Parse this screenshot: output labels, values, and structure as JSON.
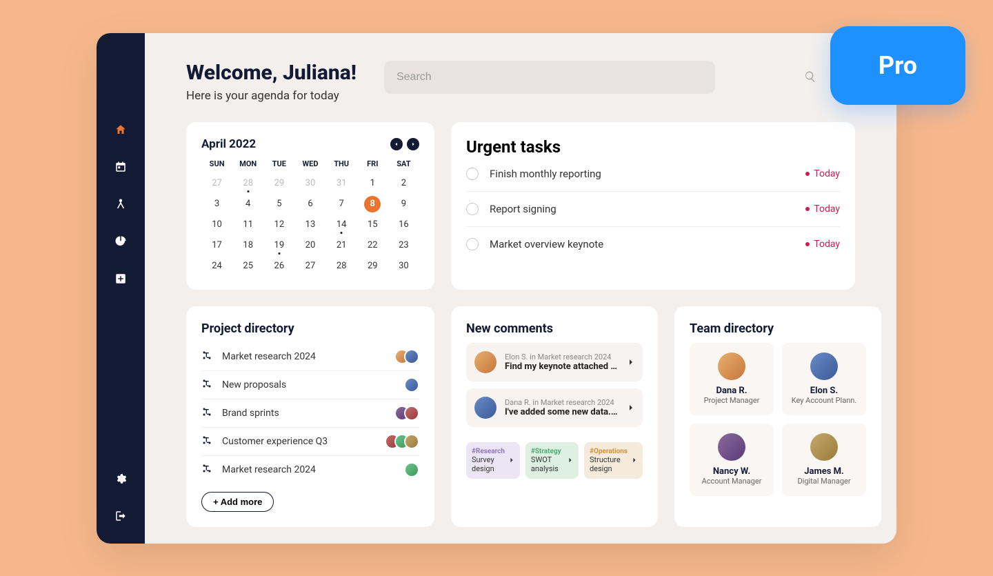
{
  "pro_label": "Pro",
  "header": {
    "title": "Welcome, Juliana!",
    "subtitle": "Here is your agenda for today"
  },
  "search": {
    "placeholder": "Search"
  },
  "calendar": {
    "month": "April 2022",
    "dow": [
      "SUN",
      "MON",
      "TUE",
      "WED",
      "THU",
      "FRI",
      "SAT"
    ],
    "cells": [
      {
        "n": "27",
        "muted": true
      },
      {
        "n": "28",
        "muted": true,
        "dot": true
      },
      {
        "n": "29",
        "muted": true
      },
      {
        "n": "30",
        "muted": true
      },
      {
        "n": "31",
        "muted": true
      },
      {
        "n": "1"
      },
      {
        "n": "2"
      },
      {
        "n": "3"
      },
      {
        "n": "4"
      },
      {
        "n": "5"
      },
      {
        "n": "6"
      },
      {
        "n": "7"
      },
      {
        "n": "8",
        "today": true
      },
      {
        "n": "9"
      },
      {
        "n": "10"
      },
      {
        "n": "11"
      },
      {
        "n": "12"
      },
      {
        "n": "13"
      },
      {
        "n": "14",
        "dot": true
      },
      {
        "n": "15"
      },
      {
        "n": "16"
      },
      {
        "n": "17"
      },
      {
        "n": "18"
      },
      {
        "n": "19",
        "dot": true
      },
      {
        "n": "20"
      },
      {
        "n": "21"
      },
      {
        "n": "22"
      },
      {
        "n": "23"
      },
      {
        "n": "24"
      },
      {
        "n": "25"
      },
      {
        "n": "26"
      },
      {
        "n": "27"
      },
      {
        "n": "28"
      },
      {
        "n": "29"
      },
      {
        "n": "30"
      }
    ]
  },
  "urgent": {
    "title": "Urgent tasks",
    "tasks": [
      {
        "label": "Finish monthly reporting",
        "due": "Today"
      },
      {
        "label": "Report signing",
        "due": "Today"
      },
      {
        "label": "Market overview keynote",
        "due": "Today"
      }
    ]
  },
  "projects": {
    "title": "Project directory",
    "items": [
      {
        "name": "Market research 2024",
        "avatars": 2
      },
      {
        "name": "New proposals",
        "avatars": 1
      },
      {
        "name": "Brand sprints",
        "avatars": 2
      },
      {
        "name": "Customer experience Q3",
        "avatars": 3
      },
      {
        "name": "Market research 2024",
        "avatars": 1
      }
    ],
    "add_label": "+ Add more"
  },
  "comments": {
    "title": "New comments",
    "items": [
      {
        "meta": "Elon S. in Market research 2024",
        "text": "Find my keynote attached in the.."
      },
      {
        "meta": "Dana R. in Market research 2024",
        "text": "I've added some new data. Let's.."
      }
    ],
    "chips": [
      {
        "tag": "#Research",
        "label": "Survey design",
        "cls": "purple"
      },
      {
        "tag": "#Strategy",
        "label": "SWOT analysis",
        "cls": "green"
      },
      {
        "tag": "#Operations",
        "label": "Structure design",
        "cls": "orange"
      }
    ]
  },
  "team": {
    "title": "Team directory",
    "members": [
      {
        "name": "Dana R.",
        "role": "Project Manager",
        "av": "av1"
      },
      {
        "name": "Elon S.",
        "role": "Key Account Plann.",
        "av": "av2"
      },
      {
        "name": "Nancy W.",
        "role": "Account Manager",
        "av": "av3"
      },
      {
        "name": "James M.",
        "role": "Digital Manager",
        "av": "av6"
      }
    ]
  }
}
